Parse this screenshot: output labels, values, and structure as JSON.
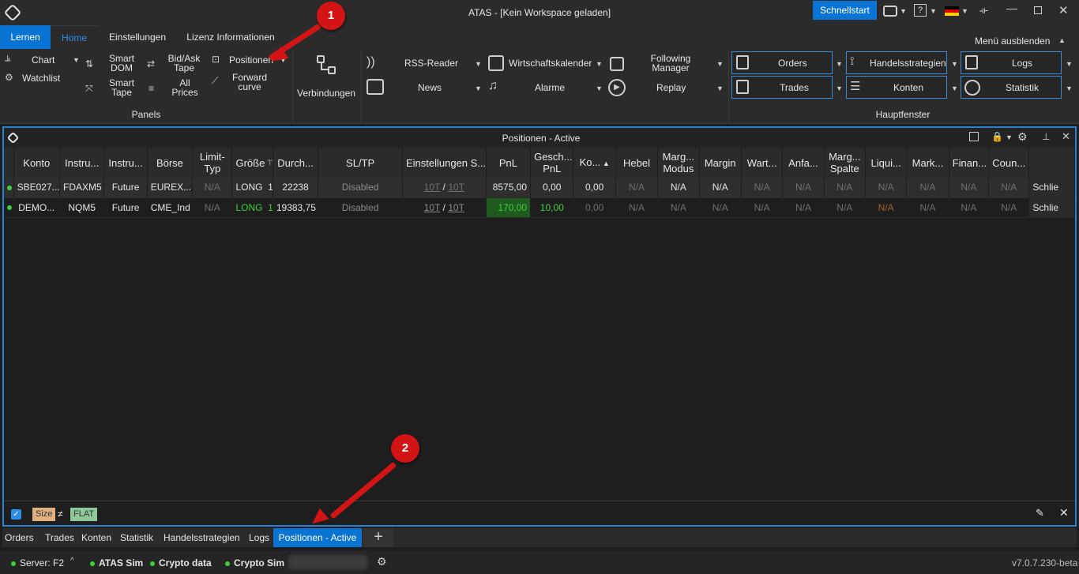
{
  "app": {
    "title": "ATAS - [Kein Workspace geladen]",
    "quickstart": "Schnellstart",
    "help": "?"
  },
  "menu_tabs": [
    "Lernen",
    "Home",
    "Einstellungen",
    "Lizenz Informationen"
  ],
  "hide_menu": "Menü ausblenden",
  "ribbon": {
    "chart": "Chart",
    "watchlist": "Watchlist",
    "smart_dom": "Smart DOM",
    "smart_tape": "Smart Tape",
    "bidask_tape": "Bid/Ask Tape",
    "all_prices": "All Prices",
    "positions": "Positionen",
    "forward_curve": "Forward curve",
    "panels_group": "Panels",
    "connections": "Verbindungen",
    "rss": "RSS-Reader",
    "news": "News",
    "calendar": "Wirtschaftskalender",
    "alarms": "Alarme",
    "following_manager": "Following Manager",
    "replay": "Replay",
    "orders": "Orders",
    "trades": "Trades",
    "strategies": "Handelsstrategien",
    "accounts": "Konten",
    "logs": "Logs",
    "statistics": "Statistik",
    "main_group": "Hauptfenster"
  },
  "panel": {
    "title": "Positionen - Active",
    "columns": [
      "Konto",
      "Instru...",
      "Instru...",
      "Börse",
      "Limit-Typ",
      "Größe",
      "Durch...",
      "SL/TP",
      "Einstellungen S...",
      "PnL",
      "Gesch... PnL",
      "Ko...",
      "Hebel",
      "Marg... Modus",
      "Margin",
      "Wart...",
      "Anfa...",
      "Marg... Spalte",
      "Liqui...",
      "Mark...",
      "Finan...",
      "Coun..."
    ],
    "rows": [
      {
        "account": "SBE027...",
        "instrument": "FDAXM5",
        "type": "Future",
        "exchange": "EUREX...",
        "limit_type": "N/A",
        "side": "LONG",
        "qty": "1",
        "avg": "22238",
        "sltp": "Disabled",
        "settings_a": "10T",
        "settings_b": "10T",
        "pnl": "8575,00",
        "closed_pnl": "0,00",
        "ko": "0,00",
        "leverage": "N/A",
        "margin_mode": "N/A",
        "margin": "N/A",
        "wait": "N/A",
        "initial": "N/A",
        "margin_col": "N/A",
        "liqui": "N/A",
        "mark": "N/A",
        "finan": "N/A",
        "count": "N/A",
        "close": "Schlie"
      },
      {
        "account": "DEMO...",
        "instrument": "NQM5",
        "type": "Future",
        "exchange": "CME_Ind",
        "limit_type": "N/A",
        "side": "LONG",
        "qty": "1",
        "avg": "19383,75",
        "sltp": "Disabled",
        "settings_a": "10T",
        "settings_b": "10T",
        "pnl": "170,00",
        "closed_pnl": "10,00",
        "ko": "0,00",
        "leverage": "N/A",
        "margin_mode": "N/A",
        "margin": "N/A",
        "wait": "N/A",
        "initial": "N/A",
        "margin_col": "N/A",
        "liqui": "N/A",
        "mark": "N/A",
        "finan": "N/A",
        "count": "N/A",
        "close": "Schlie"
      }
    ],
    "filter": {
      "field": "Size",
      "op": "≠",
      "value": "FLAT"
    }
  },
  "bottom_tabs": [
    "Orders",
    "Trades",
    "Konten",
    "Statistik",
    "Handelsstrategien",
    "Logs",
    "Positionen - Active"
  ],
  "status": {
    "server": "Server: F2",
    "c1": "ATAS Sim",
    "c2": "Crypto data",
    "c3": "Crypto Sim",
    "version": "v7.0.7.230-beta"
  },
  "annotations": [
    "1",
    "2"
  ],
  "colors": {
    "accent": "#0a74d4",
    "highlight_red": "#d31414",
    "green": "#3ecf3e"
  }
}
